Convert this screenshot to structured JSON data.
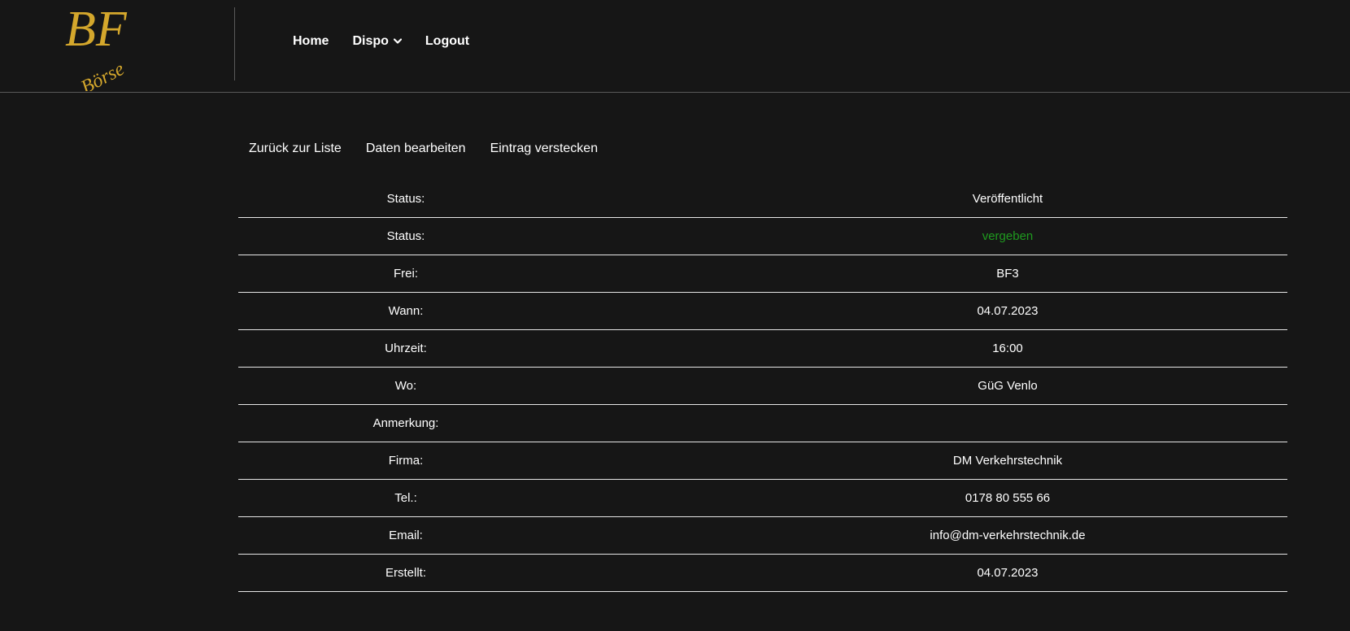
{
  "logo": {
    "line1": "BF",
    "line2": "Börse",
    "color": "#d4a72c"
  },
  "nav": {
    "items": [
      {
        "label": "Home",
        "has_dropdown": false
      },
      {
        "label": "Dispo",
        "has_dropdown": true
      },
      {
        "label": "Logout",
        "has_dropdown": false
      }
    ]
  },
  "actions": {
    "back": "Zurück zur Liste",
    "edit": "Daten bearbeiten",
    "hide": "Eintrag verstecken"
  },
  "details": {
    "rows": [
      {
        "label": "Status:",
        "value": "Veröffentlicht"
      },
      {
        "label": "Status:",
        "value": "vergeben",
        "value_color": "#1f9a1f"
      },
      {
        "label": "Frei:",
        "value": "BF3"
      },
      {
        "label": "Wann:",
        "value": "04.07.2023"
      },
      {
        "label": "Uhrzeit:",
        "value": "16:00"
      },
      {
        "label": "Wo:",
        "value": "GüG Venlo"
      },
      {
        "label": "Anmerkung:",
        "value": ""
      },
      {
        "label": "Firma:",
        "value": "DM Verkehrstechnik"
      },
      {
        "label": "Tel.:",
        "value": "0178 80 555 66"
      },
      {
        "label": "Email:",
        "value": "info@dm-verkehrstechnik.de"
      },
      {
        "label": "Erstellt:",
        "value": "04.07.2023"
      }
    ]
  }
}
